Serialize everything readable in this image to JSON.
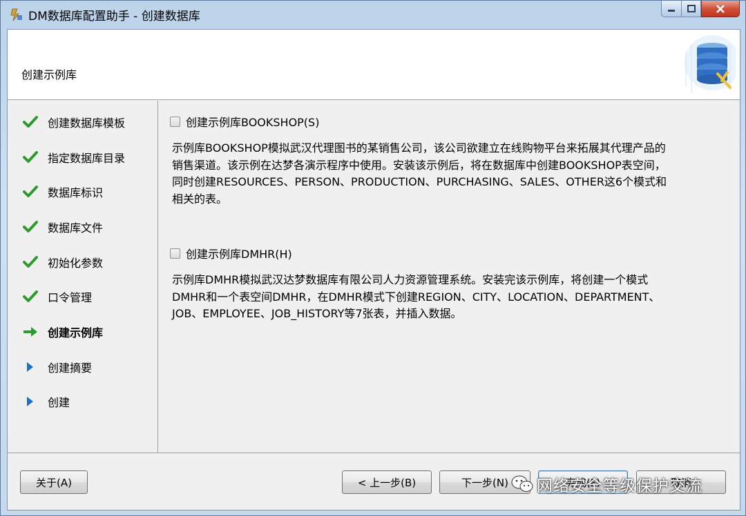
{
  "window": {
    "title": "DM数据库配置助手 - 创建数据库"
  },
  "header": {
    "title": "创建示例库"
  },
  "steps": [
    {
      "label": "创建数据库模板",
      "status": "done"
    },
    {
      "label": "指定数据库目录",
      "status": "done"
    },
    {
      "label": "数据库标识",
      "status": "done"
    },
    {
      "label": "数据库文件",
      "status": "done"
    },
    {
      "label": "初始化参数",
      "status": "done"
    },
    {
      "label": "口令管理",
      "status": "done"
    },
    {
      "label": "创建示例库",
      "status": "current"
    },
    {
      "label": "创建摘要",
      "status": "pending"
    },
    {
      "label": "创建",
      "status": "pending"
    }
  ],
  "options": {
    "bookshop": {
      "label": "创建示例库BOOKSHOP(S)",
      "checked": false,
      "desc": [
        "示例库BOOKSHOP模拟武汉代理图书的某销售公司，该公司欲建立在线购物平台来拓展其代理产品的",
        "销售渠道。该示例在达梦各演示程序中使用。安装该示例后，将在数据库中创建BOOKSHOP表空间，",
        "同时创建RESOURCES、PERSON、PRODUCTION、PURCHASING、SALES、OTHER这6个模式和",
        "相关的表。"
      ]
    },
    "dmhr": {
      "label": "创建示例库DMHR(H)",
      "checked": false,
      "desc": [
        "示例库DMHR模拟武汉达梦数据库有限公司人力资源管理系统。安装完该示例库，将创建一个模式",
        "DMHR和一个表空间DMHR，在DMHR模式下创建REGION、CITY、LOCATION、DEPARTMENT、",
        "JOB、EMPLOYEE、JOB_HISTORY等7张表，并插入数据。"
      ]
    }
  },
  "footer": {
    "about": "关于(A)",
    "prev": "< 上一步(B)",
    "next": "下一步(N)",
    "finish": "完成(F)",
    "cancel": "取消"
  },
  "watermark": {
    "text": "网络安全等级保护交流"
  },
  "colors": {
    "check": "#2e9a2e",
    "arrow_current": "#2e9a2e",
    "arrow_pending": "#1f6fbf"
  }
}
